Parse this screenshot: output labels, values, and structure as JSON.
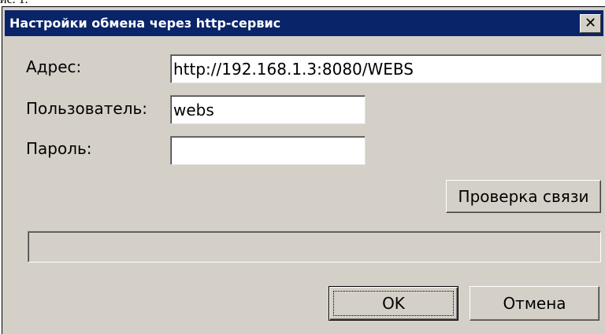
{
  "page": {
    "prefix_text": "ис. 1."
  },
  "dialog": {
    "title": "Настройки обмена через http-сервис",
    "close_glyph": "✕"
  },
  "form": {
    "address_label": "Адрес:",
    "address_value": "http://192.168.1.3:8080/WEBS",
    "user_label": "Пользователь:",
    "user_value": "webs",
    "password_label": "Пароль:",
    "password_value": ""
  },
  "buttons": {
    "check_connection": "Проверка связи",
    "ok": "OK",
    "cancel": "Отмена"
  },
  "progress": {
    "percent": 0
  },
  "colors": {
    "titlebar": "#0a246a",
    "dialog_bg": "#d4d0c8",
    "field_bg": "#ffffff"
  }
}
